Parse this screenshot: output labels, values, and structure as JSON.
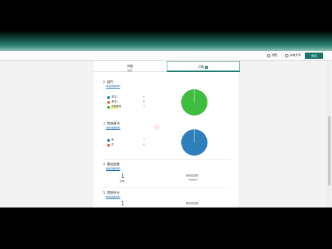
{
  "toolbar": {
    "preview_label": "預覽",
    "share_label": "與其共享",
    "send_label": "傳送"
  },
  "tabs": {
    "left": {
      "label": "問題",
      "sub": "回答"
    },
    "right": {
      "label": "回應",
      "badge": "1"
    }
  },
  "questions": [
    {
      "title": "2. 試門",
      "link": "其他詳細資料",
      "options": [
        {
          "label": "選項1",
          "count": "0",
          "color": "#2b7bb9"
        },
        {
          "label": "選項2",
          "count": "0",
          "color": "#e06c2c"
        },
        {
          "label": "其他選項",
          "count": "1",
          "color": "#36b53a"
        }
      ],
      "pie_color": "#3ebd3e"
    },
    {
      "title": "3. 問題選項",
      "link": "其他詳細資料",
      "options": [
        {
          "label": "是",
          "count": "1",
          "color": "#2b7bb9"
        },
        {
          "label": "否",
          "count": "0",
          "color": "#e06c2c"
        }
      ],
      "pie_color": "#2f7fbd"
    },
    {
      "title": "4. 簡短回應",
      "link": "其他詳細資料",
      "count": "1",
      "count_label": "回應",
      "latest_label": "最新的回應",
      "latest_value": "\"aaaaa\""
    },
    {
      "title": "5. 問題評分",
      "link": "其他詳細資料",
      "count": "1",
      "latest_label": "最新的回應"
    }
  ]
}
